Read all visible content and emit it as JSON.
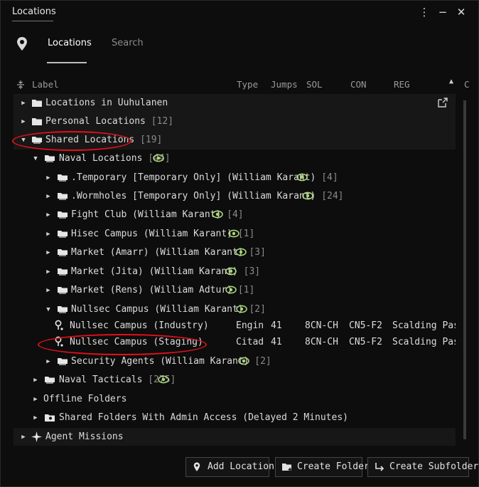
{
  "window": {
    "title": "Locations",
    "menu_glyph": "⋮",
    "minimize_glyph": "−",
    "close_glyph": "✕"
  },
  "tabs": {
    "active": "Locations",
    "inactive": "Search"
  },
  "columns": {
    "label": "Label",
    "type": "Type",
    "jumps": "Jumps",
    "sol": "SOL",
    "con": "CON",
    "reg": "REG",
    "cut": "C"
  },
  "tree": {
    "locations_in": "Locations in Uuhulanen",
    "personal": {
      "label": "Personal Locations",
      "count": "[12]"
    },
    "shared": {
      "label": "Shared Locations",
      "count": "[19]"
    },
    "naval_locations": {
      "label": "Naval Locations",
      "count": "[44]"
    },
    "folders": [
      {
        "label": ".Temporary [Temporary Only] (William Karant)",
        "count": "[4]"
      },
      {
        "label": ".Wormholes [Temporary Only] (William Karant)",
        "count": "[24]"
      },
      {
        "label": "Fight Club (William Karant)",
        "count": "[4]"
      },
      {
        "label": "Hisec Campus (William Karant)",
        "count": "[1]"
      },
      {
        "label": "Market (Amarr) (William Karant)",
        "count": "[3]"
      },
      {
        "label": "Market (Jita) (William Karant)",
        "count": "[3]"
      },
      {
        "label": "Market (Rens) (William Adtur)",
        "count": "[1]"
      },
      {
        "label": "Nullsec Campus (William Karant)",
        "count": "[2]"
      }
    ],
    "nullsec_children": [
      {
        "label": "Nullsec Campus (Industry)",
        "type": "Engin",
        "jumps": "41",
        "sol": "8CN-CH",
        "con": "CN5-F2",
        "reg": "Scalding Pass"
      },
      {
        "label": "Nullsec Campus (Staging)",
        "type": "Citad",
        "jumps": "41",
        "sol": "8CN-CH",
        "con": "CN5-F2",
        "reg": "Scalding Pass"
      }
    ],
    "security_agents": {
      "label": "Security Agents (William Karant)",
      "count": "[2]"
    },
    "naval_tacticals": {
      "label": "Naval Tacticals",
      "count": "[275]"
    },
    "offline_folders": "Offline Folders",
    "shared_admin": "Shared Folders With Admin Access (Delayed 2 Minutes)",
    "agent_missions": "Agent Missions"
  },
  "buttons": {
    "add_location": "Add Location",
    "create_folder": "Create Folder",
    "create_subfolder": "Create Subfolder"
  },
  "colors": {
    "eye": "#a9d67a",
    "highlight_circle": "#e0101a"
  },
  "icons": [
    "pin-icon",
    "folder-icon",
    "shared-folder-icon",
    "eye-icon",
    "location-icon",
    "external-link-icon",
    "star-icon"
  ]
}
